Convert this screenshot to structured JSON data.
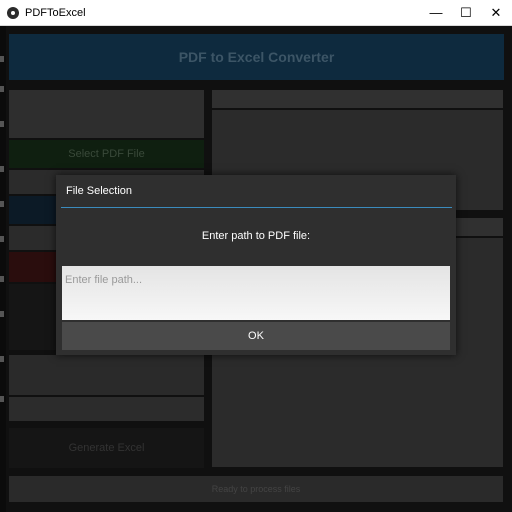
{
  "window": {
    "title": "PDFToExcel",
    "controls": {
      "minimize": "—",
      "maximize": "☐",
      "close": "✕"
    }
  },
  "app": {
    "header_title": "PDF to Excel Converter",
    "select_pdf_button": "Select PDF File",
    "generate_button": "Generate Excel",
    "status": "Ready to process files"
  },
  "dialog": {
    "title": "File Selection",
    "prompt": "Enter path to PDF file:",
    "input_value": "",
    "input_placeholder": "Enter file path...",
    "ok_label": "OK"
  },
  "colors": {
    "accent": "#3b8bbd",
    "header_bg": "#0e2a3e",
    "dialog_bg": "#2f2f2f"
  }
}
